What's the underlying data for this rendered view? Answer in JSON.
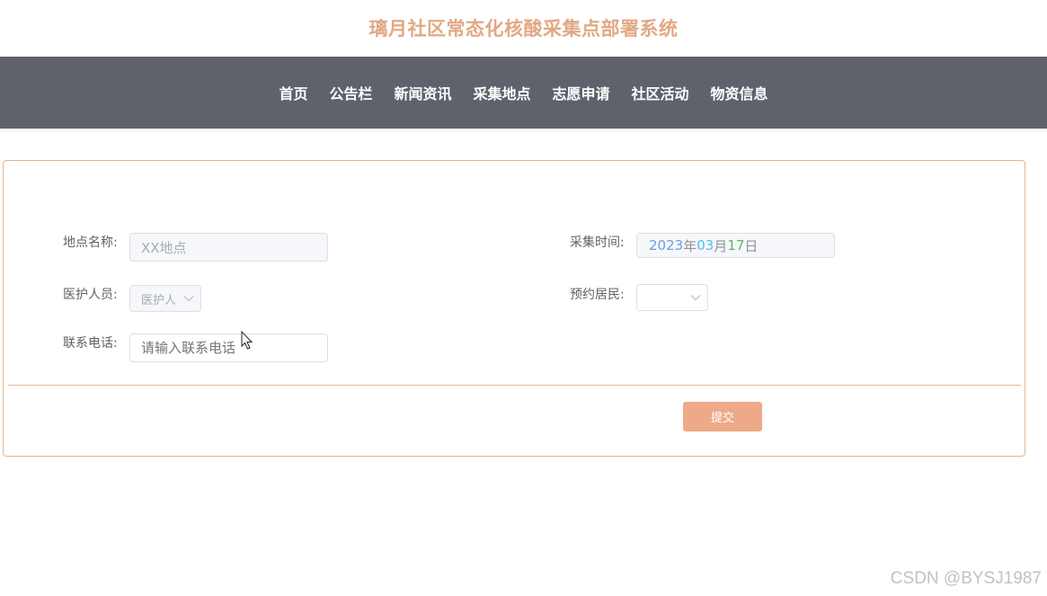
{
  "header": {
    "title": "璃月社区常态化核酸采集点部署系统",
    "title_color": "#e2a885"
  },
  "nav": {
    "background": "#5f626b",
    "items": [
      "首页",
      "公告栏",
      "新闻资讯",
      "采集地点",
      "志愿申请",
      "社区活动",
      "物资信息"
    ]
  },
  "form": {
    "border_color": "#e1b78e",
    "location_name": {
      "label": "地点名称:",
      "value": "XX地点"
    },
    "collect_time": {
      "label": "采集时间:",
      "year": "2023",
      "year_unit": "年",
      "month": "03",
      "month_unit": "月",
      "day": "17",
      "day_unit": "日",
      "year_color": "#6aa0d8",
      "month_color": "#4fc3e6",
      "day_color": "#5cb85c"
    },
    "medical_staff": {
      "label": "医护人员:",
      "value": "医护人"
    },
    "reserved_resident": {
      "label": "预约居民:",
      "value": ""
    },
    "phone": {
      "label": "联系电话:",
      "placeholder": "请输入联系电话"
    },
    "submit": {
      "label": "提交",
      "color": "#eeaa88"
    }
  },
  "watermark": "CSDN @BYSJ1987"
}
